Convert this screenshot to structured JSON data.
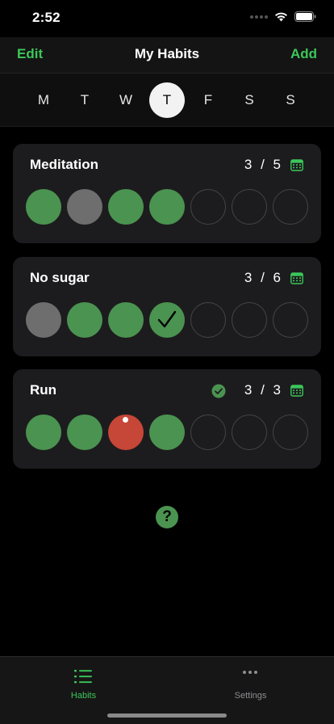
{
  "status": {
    "time": "2:52"
  },
  "nav": {
    "edit_label": "Edit",
    "title": "My Habits",
    "add_label": "Add"
  },
  "days": [
    {
      "label": "M",
      "selected": false
    },
    {
      "label": "T",
      "selected": false
    },
    {
      "label": "W",
      "selected": false
    },
    {
      "label": "T",
      "selected": true
    },
    {
      "label": "F",
      "selected": false
    },
    {
      "label": "S",
      "selected": false
    },
    {
      "label": "S",
      "selected": false
    }
  ],
  "habits": [
    {
      "name": "Meditation",
      "done": "3",
      "sep": "/",
      "goal": "5",
      "goal_met": false,
      "days": [
        "done",
        "skip",
        "done",
        "done",
        "empty",
        "empty",
        "empty"
      ]
    },
    {
      "name": "No sugar",
      "done": "3",
      "sep": "/",
      "goal": "6",
      "goal_met": false,
      "days": [
        "skip",
        "done",
        "done",
        "done-check",
        "empty",
        "empty",
        "empty"
      ]
    },
    {
      "name": "Run",
      "done": "3",
      "sep": "/",
      "goal": "3",
      "goal_met": true,
      "days": [
        "done",
        "done",
        "fail",
        "done",
        "empty",
        "empty",
        "empty"
      ]
    }
  ],
  "colors": {
    "accent": "#3cc75a",
    "done": "#4b9350",
    "skip": "#6e6e6e",
    "fail": "#c64637",
    "card": "#1c1c1e"
  },
  "help": {
    "label": "?"
  },
  "tabs": [
    {
      "label": "Habits",
      "icon": "list-icon",
      "active": true
    },
    {
      "label": "Settings",
      "icon": "more-icon",
      "active": false
    }
  ]
}
